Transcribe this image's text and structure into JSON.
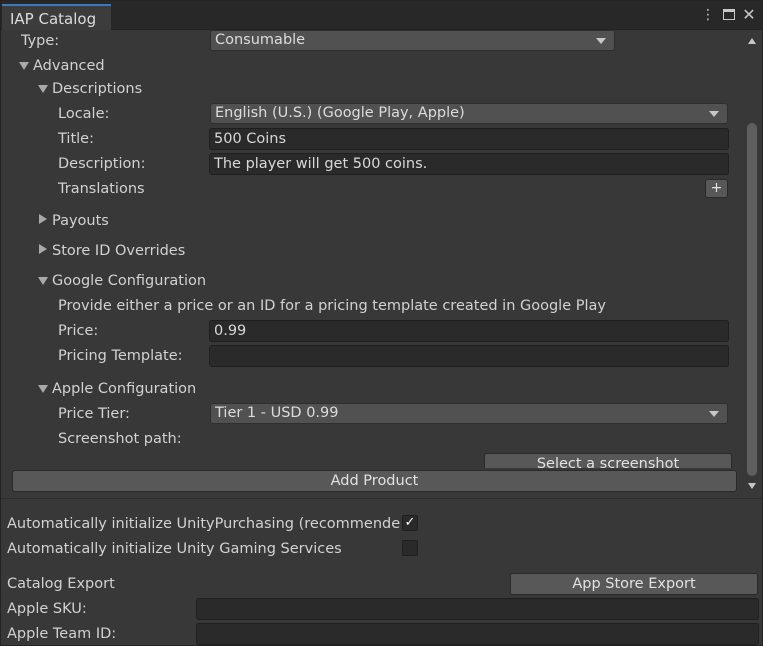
{
  "window": {
    "tab_title": "IAP Catalog",
    "menu_icon": "kebab-menu-icon",
    "maximize_icon": "maximize-icon",
    "close_icon": "close-icon"
  },
  "product": {
    "type_label": "Type:",
    "type_value": "Consumable",
    "advanced_label": "Advanced",
    "descriptions": {
      "label": "Descriptions",
      "locale_label": "Locale:",
      "locale_value": "English (U.S.) (Google Play, Apple)",
      "title_label": "Title:",
      "title_value": "500 Coins",
      "description_label": "Description:",
      "description_value": "The player will get 500 coins.",
      "translations_label": "Translations",
      "add_translation": "+"
    },
    "payouts_label": "Payouts",
    "store_id_overrides_label": "Store ID Overrides",
    "google": {
      "label": "Google Configuration",
      "hint": "Provide either a price or an ID for a pricing template created in Google Play",
      "price_label": "Price:",
      "price_value": "0.99",
      "pricing_template_label": "Pricing Template:",
      "pricing_template_value": ""
    },
    "apple": {
      "label": "Apple Configuration",
      "price_tier_label": "Price Tier:",
      "price_tier_value": "Tier 1 - USD 0.99",
      "screenshot_path_label": "Screenshot path:",
      "select_screenshot_button": "Select a screenshot"
    }
  },
  "add_product_button": "Add Product",
  "settings": {
    "auto_init_purchasing_label": "Automatically initialize UnityPurchasing (recommended)",
    "auto_init_purchasing_checked": true,
    "auto_init_ugs_label": "Automatically initialize Unity Gaming Services",
    "auto_init_ugs_checked": false,
    "check_glyph": "✓"
  },
  "export": {
    "catalog_export_label": "Catalog Export",
    "app_store_export_button": "App Store Export",
    "apple_sku_label": "Apple SKU:",
    "apple_sku_value": "",
    "apple_team_id_label": "Apple Team ID:",
    "apple_team_id_value": ""
  },
  "colors": {
    "background": "#383838",
    "tab_accent": "#3a79bb",
    "field_background": "#2a2a2a",
    "button_background": "#585858"
  }
}
